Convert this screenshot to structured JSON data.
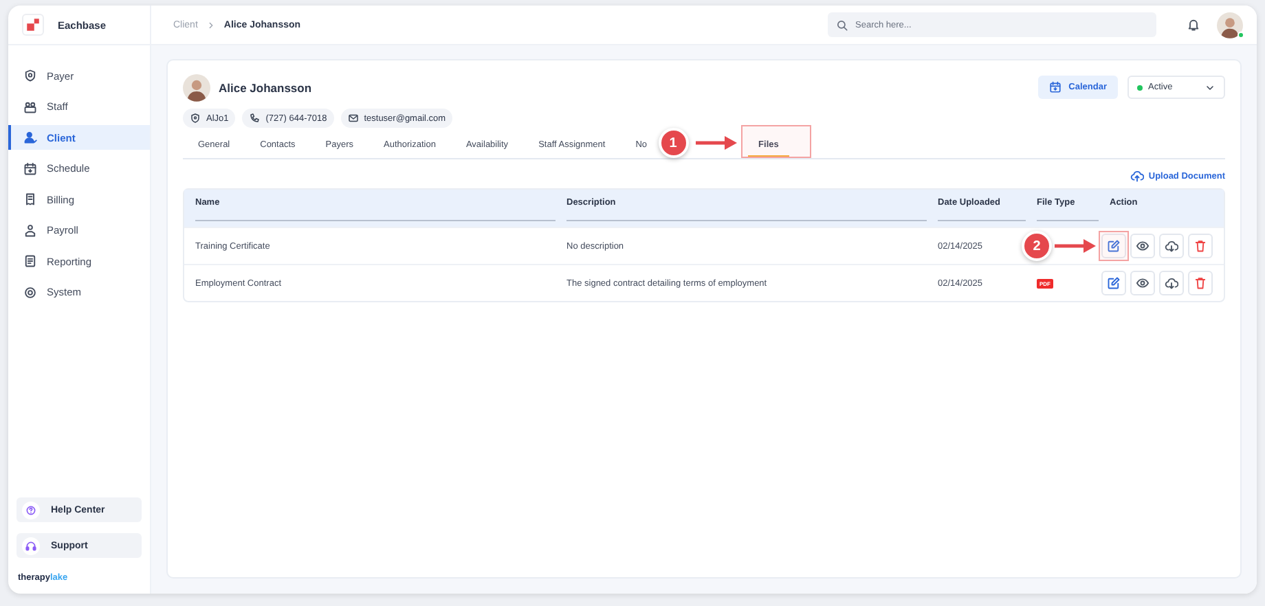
{
  "brand": {
    "name": "Eachbase"
  },
  "sidebar": {
    "items": [
      {
        "label": "Payer",
        "selected": false
      },
      {
        "label": "Staff",
        "selected": false
      },
      {
        "label": "Client",
        "selected": true
      },
      {
        "label": "Schedule",
        "selected": false
      },
      {
        "label": "Billing",
        "selected": false
      },
      {
        "label": "Payroll",
        "selected": false
      },
      {
        "label": "Reporting",
        "selected": false
      },
      {
        "label": "System",
        "selected": false
      }
    ],
    "bottom": [
      {
        "label": "Help Center"
      },
      {
        "label": "Support"
      }
    ],
    "footer_logo": {
      "part_1": "therapy",
      "part_2": "lake"
    }
  },
  "breadcrumb": [
    "Client",
    "Alice Johansson"
  ],
  "search": {
    "placeholder": "Search here..."
  },
  "client": {
    "name": "Alice Johansson",
    "chips": [
      {
        "kind": "id",
        "text": "AlJo1"
      },
      {
        "kind": "phone",
        "text": "(727) 644-7018"
      },
      {
        "kind": "email",
        "text": "testuser@gmail.com"
      }
    ]
  },
  "calendar_button": "Calendar",
  "status": {
    "label": "Active",
    "color": "#22c55e"
  },
  "tabs": [
    {
      "label": "General",
      "selected": false
    },
    {
      "label": "Contacts",
      "selected": false
    },
    {
      "label": "Payers",
      "selected": false
    },
    {
      "label": "Authorization",
      "selected": false
    },
    {
      "label": "Availability",
      "selected": false
    },
    {
      "label": "Staff Assignment",
      "selected": false
    },
    {
      "label": "No",
      "selected": false
    },
    {
      "label": "Files",
      "selected": true,
      "annotation": "1"
    }
  ],
  "upload_button": "Upload Document",
  "table": {
    "columns": [
      "Name",
      "Description",
      "Date Uploaded",
      "File Type",
      "Action"
    ],
    "rows": [
      {
        "name": "Training Certificate",
        "description": "No description",
        "date": "02/14/2025",
        "annotation": "2"
      },
      {
        "name": "Employment Contract",
        "description": "The signed contract detailing terms of employment",
        "date": "02/14/2025",
        "file_type": "PDF"
      }
    ]
  }
}
